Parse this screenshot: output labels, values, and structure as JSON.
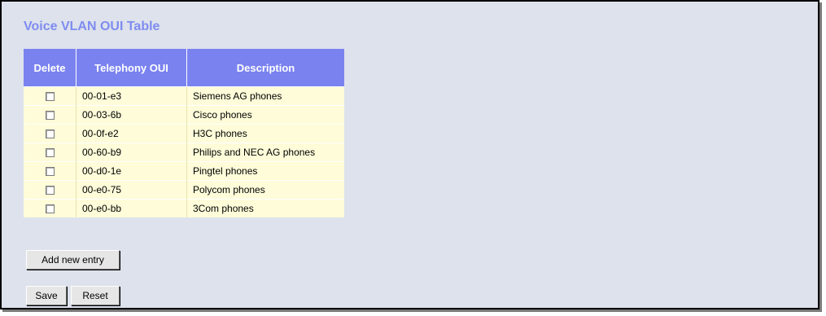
{
  "page": {
    "title": "Voice VLAN OUI Table"
  },
  "table": {
    "headers": [
      "Delete",
      "Telephony OUI",
      "Description"
    ],
    "rows": [
      {
        "oui": "00-01-e3",
        "description": "Siemens AG phones"
      },
      {
        "oui": "00-03-6b",
        "description": "Cisco phones"
      },
      {
        "oui": "00-0f-e2",
        "description": "H3C phones"
      },
      {
        "oui": "00-60-b9",
        "description": "Philips and NEC AG phones"
      },
      {
        "oui": "00-d0-1e",
        "description": "Pingtel phones"
      },
      {
        "oui": "00-e0-75",
        "description": "Polycom phones"
      },
      {
        "oui": "00-e0-bb",
        "description": "3Com phones"
      }
    ]
  },
  "buttons": {
    "add_label": "Add new entry",
    "save_label": "Save",
    "reset_label": "Reset"
  },
  "colors": {
    "title": "#7f8cf0",
    "header_bg": "#7a82f0",
    "row_bg": "#fefcd9",
    "page_bg": "#dde2ec"
  }
}
